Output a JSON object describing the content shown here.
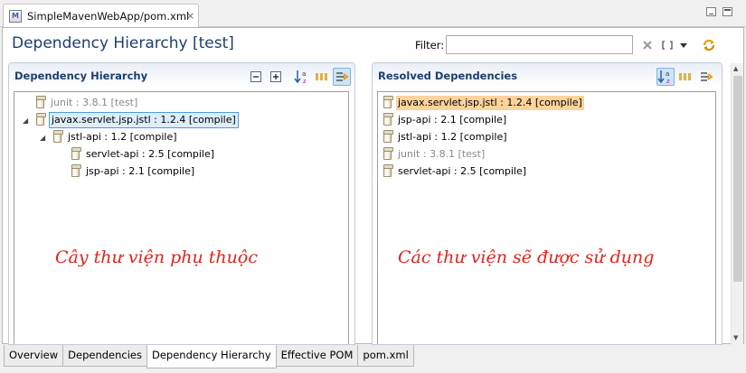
{
  "editor_tab": {
    "title": "SimpleMavenWebApp/pom.xml",
    "close_icon": "×",
    "icon_label": "M"
  },
  "header": {
    "title": "Dependency Hierarchy [test]",
    "filter_label": "Filter:",
    "filter_value": "",
    "filter_placeholder": ""
  },
  "hierarchy": {
    "title": "Dependency Hierarchy",
    "nodes": [
      {
        "label": "junit : 3.8.1 [test]"
      },
      {
        "label": "javax.servlet.jsp.jstl : 1.2.4 [compile]"
      },
      {
        "label": "jstl-api : 1.2 [compile]"
      },
      {
        "label": "servlet-api : 2.5 [compile]"
      },
      {
        "label": "jsp-api : 2.1 [compile]"
      }
    ],
    "annotation": "Cây thư viện phụ thuộc"
  },
  "resolved": {
    "title": "Resolved Dependencies",
    "items": [
      {
        "label": "javax.servlet.jsp.jstl : 1.2.4 [compile]"
      },
      {
        "label": "jsp-api : 2.1 [compile]"
      },
      {
        "label": "jstl-api : 1.2 [compile]"
      },
      {
        "label": "junit : 3.8.1 [test]"
      },
      {
        "label": "servlet-api : 2.5 [compile]"
      }
    ],
    "annotation": "Các thư viện sẽ được sử dụng"
  },
  "page_tabs": [
    {
      "label": "Overview"
    },
    {
      "label": "Dependencies"
    },
    {
      "label": "Dependency Hierarchy"
    },
    {
      "label": "Effective POM"
    },
    {
      "label": "pom.xml"
    }
  ],
  "active_page_tab": "Dependency Hierarchy",
  "colors": {
    "title": "#1e3e6b",
    "annotation": "#e2231a",
    "selection_border": "#4c9be0",
    "highlight": "#fcd39a"
  }
}
